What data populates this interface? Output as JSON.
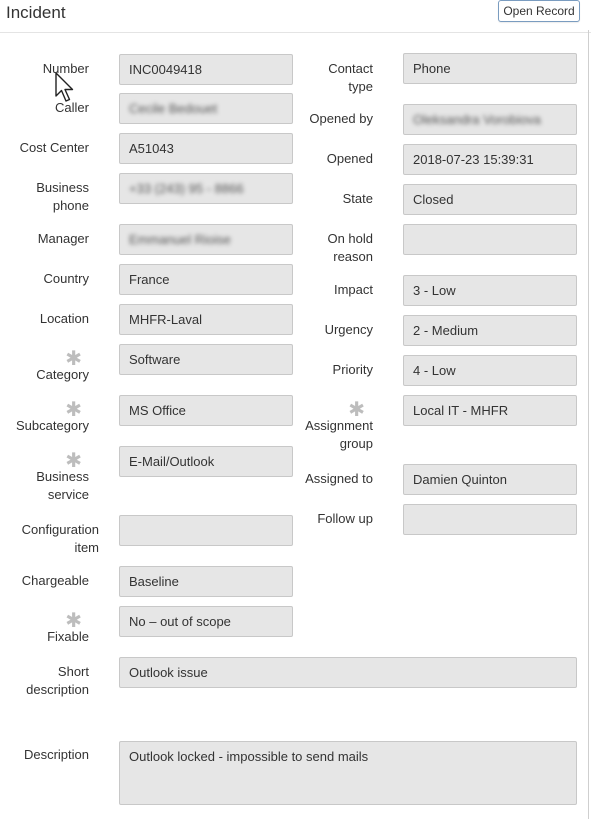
{
  "header": {
    "title": "Incident",
    "open_record_label": "Open Record"
  },
  "fields_left": {
    "number": {
      "label": "Number",
      "value": "INC0049418"
    },
    "caller": {
      "label": "Caller",
      "value": "Cecile Bedouet"
    },
    "cost_center": {
      "label": "Cost Center",
      "value": "A51043"
    },
    "business_phone": {
      "label": "Business phone",
      "label_1": "Business",
      "label_2": "phone",
      "value": "+33 (243) 95 - 8866"
    },
    "manager": {
      "label": "Manager",
      "value": "Emmanuel Rioise"
    },
    "country": {
      "label": "Country",
      "value": "France"
    },
    "location": {
      "label": "Location",
      "value": "MHFR-Laval"
    },
    "category": {
      "label": "Category",
      "value": "Software",
      "required": true
    },
    "subcategory": {
      "label": "Subcategory",
      "value": "MS Office",
      "required": true
    },
    "business_service": {
      "label_1": "Business",
      "label_2": "service",
      "value": "E-Mail/Outlook",
      "required": true
    },
    "configuration_item": {
      "label_1": "Configuration",
      "label_2": "item",
      "value": ""
    },
    "chargeable": {
      "label": "Chargeable",
      "value": "Baseline"
    },
    "fixable": {
      "label": "Fixable",
      "value": "No – out of scope",
      "required": true
    }
  },
  "fields_right": {
    "contact_type": {
      "label_1": "Contact",
      "label_2": "type",
      "value": "Phone"
    },
    "opened_by": {
      "label": "Opened by",
      "value": "Oleksandra Vorobiova"
    },
    "opened": {
      "label": "Opened",
      "value": "2018-07-23 15:39:31"
    },
    "state": {
      "label": "State",
      "value": "Closed"
    },
    "on_hold_reason": {
      "label_1": "On hold",
      "label_2": "reason",
      "value": ""
    },
    "impact": {
      "label": "Impact",
      "value": "3 - Low"
    },
    "urgency": {
      "label": "Urgency",
      "value": "2 - Medium"
    },
    "priority": {
      "label": "Priority",
      "value": "4 - Low"
    },
    "assignment_group": {
      "label_1": "Assignment",
      "label_2": "group",
      "value": "Local IT - MHFR",
      "required": true
    },
    "assigned_to": {
      "label": "Assigned to",
      "value": "Damien Quinton"
    },
    "follow_up": {
      "label": "Follow up",
      "value": ""
    }
  },
  "short_description": {
    "label_1": "Short",
    "label_2": "description",
    "value": "Outlook issue"
  },
  "description": {
    "label": "Description",
    "value": "Outlook locked - impossible to send mails"
  },
  "colors": {
    "field_bg": "#e6e6e6",
    "field_border": "#c8c8c8",
    "required_star": "#bdbdbd",
    "button_border": "#7a9cc0"
  }
}
